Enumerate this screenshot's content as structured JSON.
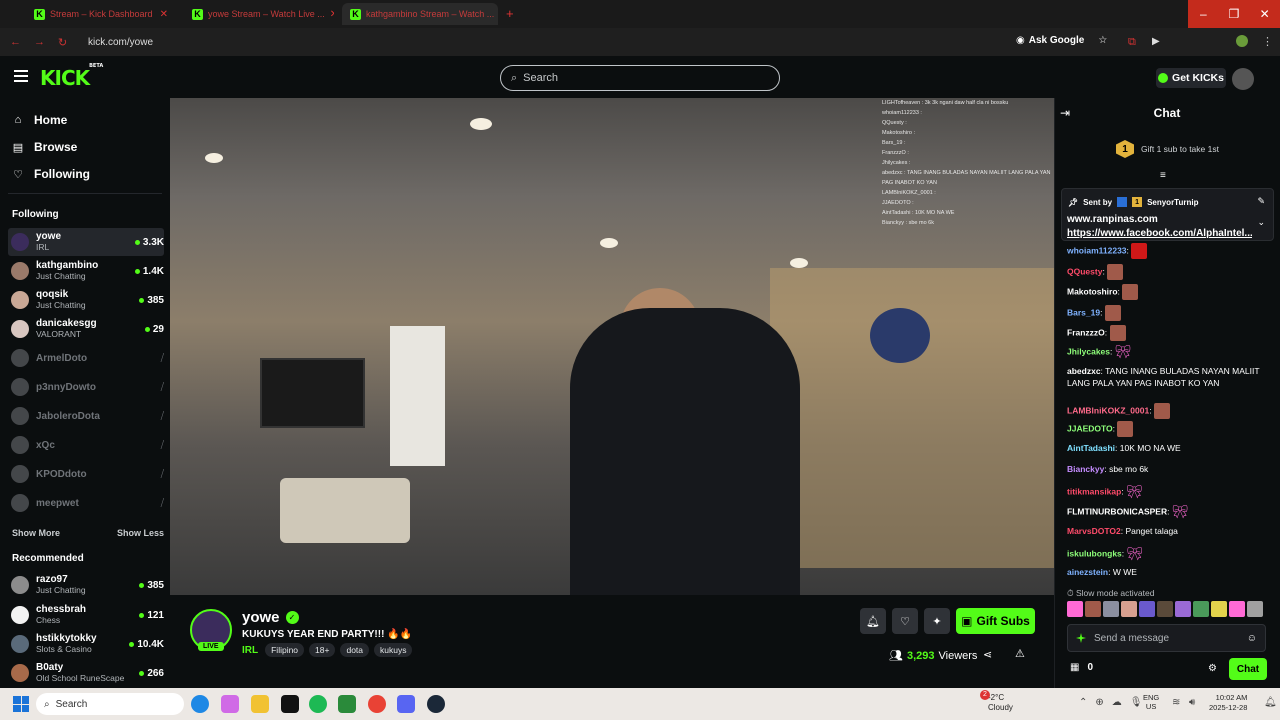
{
  "browser": {
    "tabs": [
      {
        "title": "Stream – Kick Dashboard"
      },
      {
        "title": "yowe Stream – Watch Live ..."
      },
      {
        "title": "kathgambino Stream – Watch ..."
      }
    ],
    "url": "kick.com/yowe",
    "ask_google": "Ask Google"
  },
  "header": {
    "logo": "KICK",
    "logo_tag": "BETA",
    "search_placeholder": "Search",
    "get_kicks": "Get KICKs"
  },
  "sidebar": {
    "nav": [
      {
        "label": "Home",
        "icon": "home-icon"
      },
      {
        "label": "Browse",
        "icon": "browse-icon"
      },
      {
        "label": "Following",
        "icon": "heart-icon"
      }
    ],
    "following_title": "Following",
    "following": [
      {
        "name": "yowe",
        "category": "IRL",
        "viewers": "3.3K"
      },
      {
        "name": "kathgambino",
        "category": "Just Chatting",
        "viewers": "1.4K"
      },
      {
        "name": "qoqsik",
        "category": "Just Chatting",
        "viewers": "385"
      },
      {
        "name": "danicakesgg",
        "category": "VALORANT",
        "viewers": "29"
      },
      {
        "name": "ArmelDoto"
      },
      {
        "name": "p3nnyDowto"
      },
      {
        "name": "JaboleroDota"
      },
      {
        "name": "xQc"
      },
      {
        "name": "KPODdoto"
      },
      {
        "name": "meepwet"
      }
    ],
    "show_more": "Show More",
    "show_less": "Show Less",
    "recommended_title": "Recommended",
    "recommended": [
      {
        "name": "razo97",
        "category": "Just Chatting",
        "viewers": "385"
      },
      {
        "name": "chessbrah",
        "category": "Chess",
        "viewers": "121"
      },
      {
        "name": "hstikkytokky",
        "category": "Slots & Casino",
        "viewers": "10.4K"
      },
      {
        "name": "B0aty",
        "category": "Old School RuneScape",
        "viewers": "266"
      }
    ]
  },
  "video_overlay_chat": [
    "LIGHTofheaven : 3k 3k ngani daw half cla ni bossku",
    "whoiam112233 :",
    "QQuesty :",
    "Makotoshiro :",
    "Bars_19 :",
    "FranzzzO :",
    "Jhilycakes :",
    "abedzxc : TANG INANG BULADAS NAYAN MALIIT LANG PALA YAN",
    "PAG INABOT KO YAN",
    "LAMBlniKOKZ_0001 :",
    "JJAEDOTO :",
    "AintTadashi : 10K MO NA WE",
    "Bianckyy : sbe mo 6k"
  ],
  "channel": {
    "name": "yowe",
    "live_label": "LIVE",
    "title": "KUKUYS YEAR END PARTY!!! 🔥🔥",
    "category": "IRL",
    "tags": [
      "Filipino",
      "18+",
      "dota",
      "kukuys"
    ],
    "gift_subs": "Gift Subs",
    "viewers": "3,293",
    "viewers_label": "Viewers"
  },
  "chat": {
    "title": "Chat",
    "gift_banner_num": "1",
    "gift_banner_text": "Gift 1 sub to take 1st",
    "pinned": {
      "sent_by": "Sent by",
      "badge_num": "1",
      "sender": "SenyorTurnip",
      "line1": "www.ranpinas.com",
      "line2": "https://www.facebook.com/AlphaIntel..."
    },
    "messages": [
      {
        "user": "whoiam112233",
        "color": "#7fb2ff",
        "text": "",
        "emote": "red"
      },
      {
        "user": "QQuesty",
        "color": "#ff4b6a",
        "text": "",
        "emote": "face"
      },
      {
        "user": "Makotoshiro",
        "color": "#ffffff",
        "text": "",
        "emote": "face"
      },
      {
        "user": "Bars_19",
        "color": "#7fb2ff",
        "text": "",
        "emote": "face"
      },
      {
        "user": "FranzzzO",
        "color": "#ffffff",
        "text": "",
        "emote": "face"
      },
      {
        "user": "Jhilycakes",
        "color": "#8eff7a",
        "text": "",
        "emote": "bow"
      },
      {
        "user": "abedzxc",
        "color": "#ffffff",
        "text": "TANG INANG BULADAS NAYAN MALIIT LANG PALA YAN PAG INABOT KO YAN",
        "emote": ""
      },
      {
        "user": "LAMBlniKOKZ_0001",
        "color": "#ff6a8a",
        "text": "",
        "emote": "face"
      },
      {
        "user": "JJAEDOTO",
        "color": "#8eff7a",
        "text": "",
        "emote": "face"
      },
      {
        "user": "AintTadashi",
        "color": "#7fe0ff",
        "text": "10K MO NA WE",
        "emote": ""
      },
      {
        "user": "Bianckyy",
        "color": "#c58cff",
        "text": "sbe mo 6k",
        "emote": ""
      },
      {
        "user": "titikmansikap",
        "color": "#ff4b6a",
        "text": "",
        "emote": "bow"
      },
      {
        "user": "FLMTINURBONICASPER",
        "color": "#ffffff",
        "text": "",
        "emote": "bow"
      },
      {
        "user": "MarvsDOTO2",
        "color": "#ff4b6a",
        "text": "Panget talaga",
        "emote": ""
      },
      {
        "user": "iskulubongks",
        "color": "#8eff7a",
        "text": "",
        "emote": "bow"
      },
      {
        "user": "ainezstein",
        "color": "#7fb2ff",
        "text": "W WE",
        "emote": ""
      }
    ],
    "slow_mode": "Slow mode activated",
    "input_placeholder": "Send a message",
    "points": "0",
    "send_label": "Chat"
  },
  "taskbar": {
    "search": "Search",
    "weather_temp": "-2°C",
    "weather_desc": "Cloudy",
    "weather_badge": "2",
    "lang1": "ENG",
    "lang2": "US",
    "time": "10:02 AM",
    "date": "2025-12-28"
  },
  "colors": {
    "accent": "#53fc18",
    "bg": "#0b0e0f"
  }
}
